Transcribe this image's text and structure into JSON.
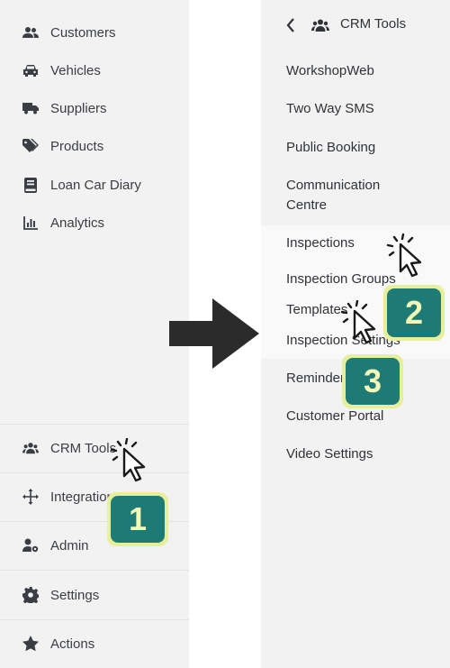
{
  "left_menu": {
    "items": [
      {
        "label": "Customers",
        "icon": "users-icon"
      },
      {
        "label": "Vehicles",
        "icon": "car-icon"
      },
      {
        "label": "Suppliers",
        "icon": "truck-icon"
      },
      {
        "label": "Products",
        "icon": "tag-icon"
      },
      {
        "label": "Loan Car Diary",
        "icon": "book-icon"
      },
      {
        "label": "Analytics",
        "icon": "chart-icon"
      }
    ],
    "bottom_items": [
      {
        "label": "CRM Tools",
        "icon": "people-group-icon"
      },
      {
        "label": "Integrations",
        "icon": "arrows-move-icon"
      },
      {
        "label": "Admin",
        "icon": "user-cog-icon"
      },
      {
        "label": "Settings",
        "icon": "gear-icon"
      },
      {
        "label": "Actions",
        "icon": "star-icon"
      }
    ]
  },
  "submenu": {
    "back_icon": "chevron-left-icon",
    "title": "CRM Tools",
    "items": [
      "WorkshopWeb",
      "Two Way SMS",
      "Public Booking",
      "Communication",
      "Centre",
      "Inspections",
      "Inspection Groups",
      "Templates",
      "Inspection Settings",
      "Reminders",
      "Customer Portal",
      "Video Settings"
    ]
  },
  "steps": {
    "step1": "1",
    "step2": "2",
    "step3": "3"
  },
  "colors": {
    "panel_bg": "#f2f2f2",
    "badge_fill": "#1e7a75",
    "badge_border": "#e7ef9a",
    "arrow": "#2b2b2b"
  }
}
